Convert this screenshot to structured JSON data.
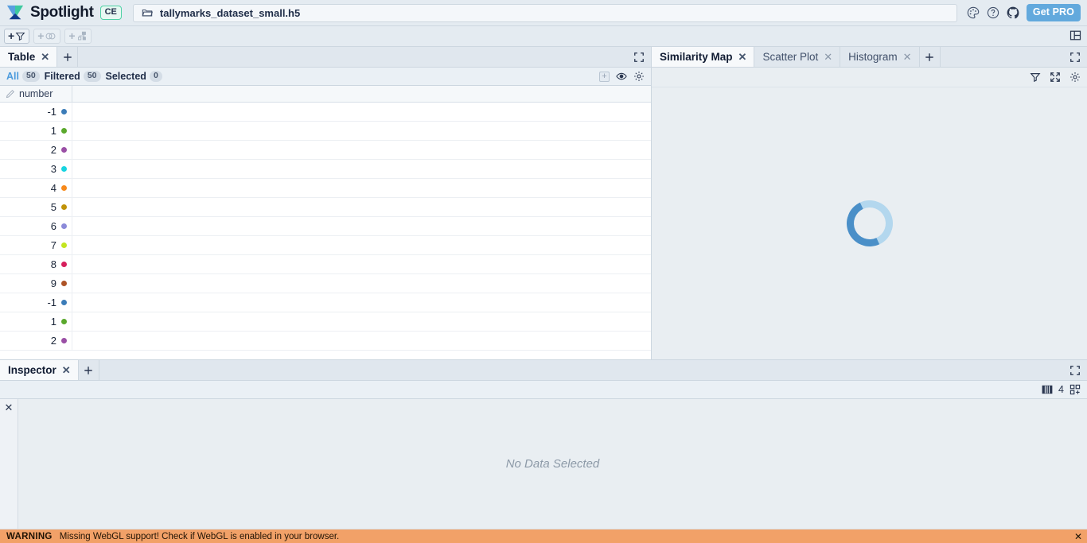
{
  "app": {
    "brand_name": "Spotlight",
    "edition_badge": "CE",
    "file_path": "tallymarks_dataset_small.h5",
    "get_pro_label": "Get PRO",
    "icons": {
      "logo": "spotlight-logo",
      "folder": "folder-icon",
      "palette": "palette-icon",
      "help": "help-circle-icon",
      "github": "github-icon",
      "layout": "layout-grid-icon"
    }
  },
  "toolbar": {
    "add_filter_label": "+",
    "add_group_label": "+",
    "add_relation_label": "+",
    "icons": {
      "filter": "funnel-icon",
      "group": "circles-icon",
      "relation": "nodes-icon",
      "layout": "layout-grid-icon"
    }
  },
  "table_panel": {
    "tabs": [
      {
        "label": "Table",
        "active": true
      }
    ],
    "add_tab_label": "+",
    "stats": [
      {
        "name": "all",
        "label": "All",
        "count": "50"
      },
      {
        "name": "filtered",
        "label": "Filtered",
        "count": "50"
      },
      {
        "name": "selected",
        "label": "Selected",
        "count": "0"
      }
    ],
    "columns": [
      {
        "label": "number",
        "icon": "pencil-icon"
      }
    ],
    "rows": [
      {
        "number": "-1",
        "color": "#3b7cb8"
      },
      {
        "number": "1",
        "color": "#5aa82c"
      },
      {
        "number": "2",
        "color": "#9a4fa5"
      },
      {
        "number": "3",
        "color": "#17d4e0"
      },
      {
        "number": "4",
        "color": "#f7891a"
      },
      {
        "number": "5",
        "color": "#c09208"
      },
      {
        "number": "6",
        "color": "#8b8ad9"
      },
      {
        "number": "7",
        "color": "#c3e520"
      },
      {
        "number": "8",
        "color": "#d61f5c"
      },
      {
        "number": "9",
        "color": "#ad5326"
      },
      {
        "number": "-1",
        "color": "#3b7cb8"
      },
      {
        "number": "1",
        "color": "#5aa82c"
      },
      {
        "number": "2",
        "color": "#9a4fa5"
      }
    ]
  },
  "right_panel": {
    "tabs": [
      {
        "label": "Similarity Map",
        "active": true
      },
      {
        "label": "Scatter Plot",
        "active": false
      },
      {
        "label": "Histogram",
        "active": false
      }
    ],
    "add_tab_label": "+",
    "state": "loading",
    "icons": {
      "filter": "funnel-icon",
      "expand": "expand-arrows-icon",
      "settings": "gear-icon",
      "fullscreen": "fullscreen-icon"
    }
  },
  "inspector": {
    "tabs": [
      {
        "label": "Inspector",
        "active": true
      }
    ],
    "add_tab_label": "+",
    "column_count": "4",
    "empty_message": "No Data Selected",
    "icons": {
      "columns": "columns-icon",
      "add_tile": "add-tile-icon",
      "fullscreen": "fullscreen-icon",
      "close": "close-icon"
    }
  },
  "status_bar": {
    "level": "WARNING",
    "message": "Missing WebGL support! Check if WebGL is enabled in your browser.",
    "close_label": "✕",
    "background": "#f2a168"
  }
}
